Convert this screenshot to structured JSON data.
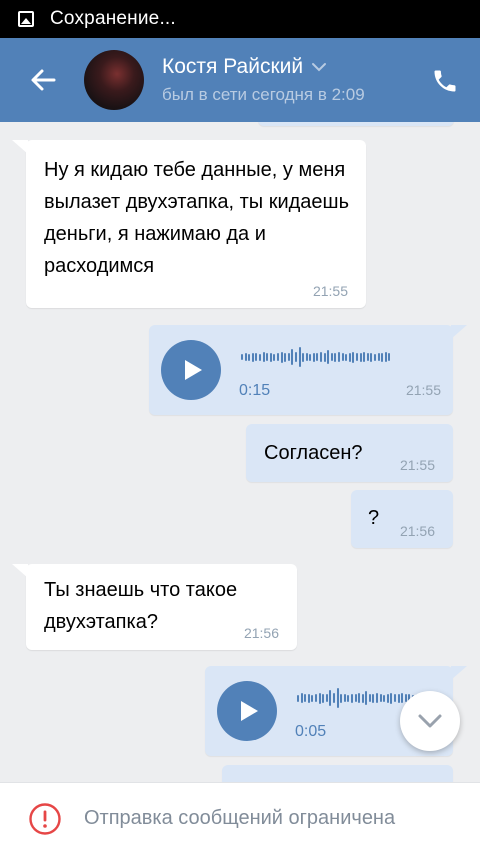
{
  "statusbar": {
    "text": "Сохранение..."
  },
  "header": {
    "name": "Костя Райский",
    "status": "был в сети сегодня в 2:09"
  },
  "messages": [
    {
      "dir": "in",
      "type": "text",
      "text": "Ну я кидаю тебе данные, у меня вылазет двухэтапка, ты кидаешь деньги, я нажимаю да и расходимся",
      "time": "21:55"
    },
    {
      "dir": "out",
      "type": "voice",
      "duration": "0:15",
      "time": "21:55"
    },
    {
      "dir": "out",
      "type": "text",
      "text": "Согласен?",
      "time": "21:55"
    },
    {
      "dir": "out",
      "type": "text",
      "text": "?",
      "time": "21:56"
    },
    {
      "dir": "in",
      "type": "text",
      "text": "Ты знаешь что такое двухэтапка?",
      "time": "21:56"
    },
    {
      "dir": "out",
      "type": "voice",
      "duration": "0:05",
      "time": ""
    }
  ],
  "footer": {
    "text": "Отправка сообщений ограничена"
  },
  "colors": {
    "accent": "#5181b8",
    "out_bubble": "#dae6f6",
    "background": "#edeef0",
    "error": "#e64646"
  }
}
